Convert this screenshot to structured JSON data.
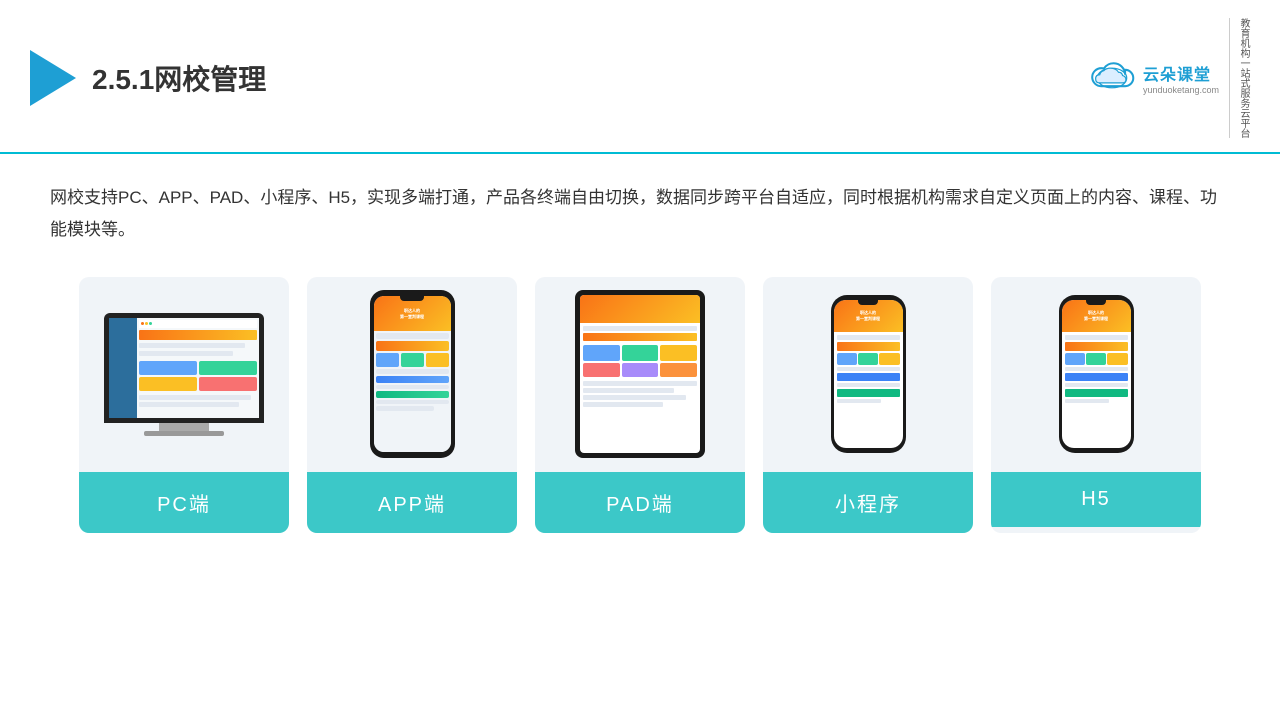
{
  "header": {
    "title": "2.5.1网校管理",
    "brand": {
      "name": "云朵课堂",
      "url": "yunduoketang.com",
      "slogan": "教育机构一站式服务云平台"
    }
  },
  "description": "网校支持PC、APP、PAD、小程序、H5，实现多端打通，产品各终端自由切换，数据同步跨平台自适应，同时根据机构需求自定义页面上的内容、课程、功能模块等。",
  "cards": [
    {
      "id": "pc",
      "label": "PC端"
    },
    {
      "id": "app",
      "label": "APP端"
    },
    {
      "id": "pad",
      "label": "PAD端"
    },
    {
      "id": "miniprogram",
      "label": "小程序"
    },
    {
      "id": "h5",
      "label": "H5"
    }
  ],
  "colors": {
    "accent": "#3cc8c8",
    "header_border": "#00bcd4",
    "card_bg": "#f0f4f8"
  }
}
